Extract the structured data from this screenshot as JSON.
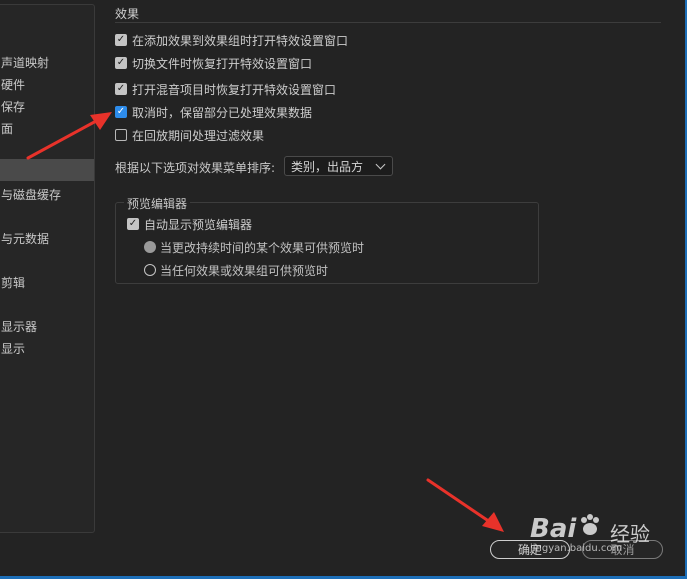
{
  "sidebar": {
    "items": [
      {
        "label": "声道映射"
      },
      {
        "label": "硬件"
      },
      {
        "label": "保存"
      },
      {
        "label": "面"
      },
      {
        "label": ""
      },
      {
        "label": "与磁盘缓存"
      },
      {
        "label": "与元数据"
      },
      {
        "label": "剪辑"
      },
      {
        "label": "显示器"
      },
      {
        "label": "显示"
      }
    ]
  },
  "effects": {
    "section_title": "效果",
    "options": [
      {
        "label": "在添加效果到效果组时打开特效设置窗口",
        "checked": true
      },
      {
        "label": "切换文件时恢复打开特效设置窗口",
        "checked": true
      },
      {
        "label": "打开混音项目时恢复打开特效设置窗口",
        "checked": true
      },
      {
        "label": "取消时，保留部分已处理效果数据",
        "checked": true
      },
      {
        "label": "在回放期间处理过滤效果",
        "checked": false
      }
    ],
    "sort_label": "根据以下选项对效果菜单排序:",
    "sort_value": "类别，出品方"
  },
  "preview_editor": {
    "group_title": "预览编辑器",
    "auto_show_label": "自动显示预览编辑器",
    "auto_show_checked": true,
    "radio_options": [
      {
        "label": "当更改持续时间的某个效果可供预览时",
        "selected": true
      },
      {
        "label": "当任何效果或效果组可供预览时",
        "selected": false
      }
    ]
  },
  "footer": {
    "ok_label": "确定",
    "cancel_label": "取消"
  },
  "watermark": {
    "brand": "Bai",
    "brand_cn": "经验",
    "url": "jingyan.baidu.com"
  },
  "colors": {
    "background": "#232323",
    "checkbox_accent": "#2d8ceb",
    "annotation_arrow": "#e8322a",
    "window_border": "#1d6fb8"
  }
}
